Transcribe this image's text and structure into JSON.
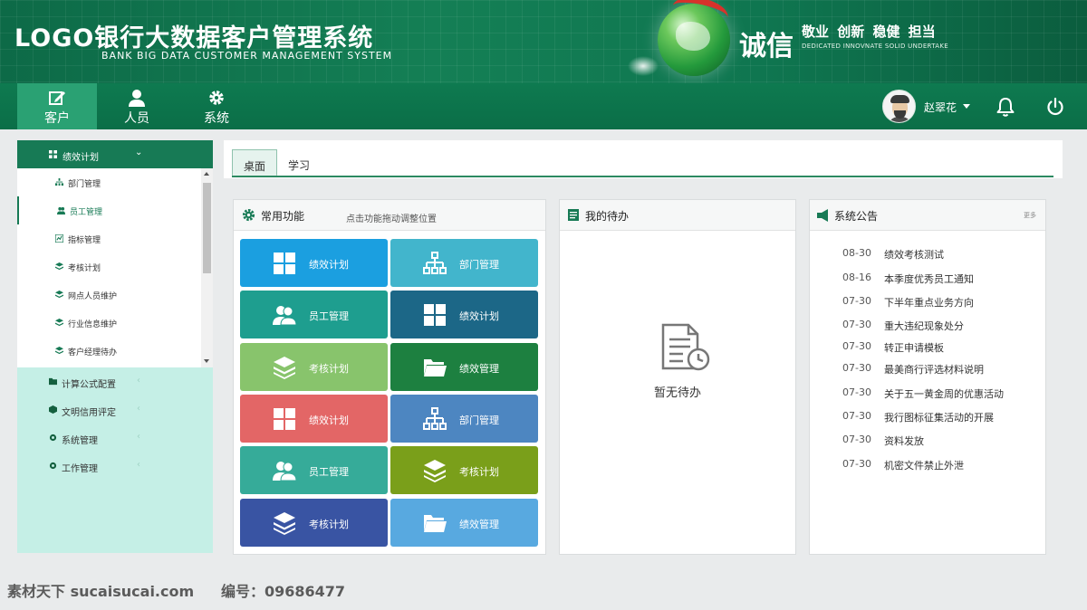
{
  "header": {
    "title": "LOGO银行大数据客户管理系统",
    "subtitle": "BANK BIG DATA CUSTOMER MANAGEMENT SYSTEM",
    "slogan": "诚信",
    "values": "敬业 创新 稳健 担当",
    "values_sub": "DEDICATED INNOVNATE SOLID UNDERTAKE"
  },
  "topnav": {
    "items": [
      {
        "label": "客户",
        "icon": "edit-icon",
        "active": true
      },
      {
        "label": "人员",
        "icon": "user-icon",
        "active": false
      },
      {
        "label": "系统",
        "icon": "gear-icon",
        "active": false
      }
    ],
    "user_name": "赵翠花"
  },
  "sidebar": {
    "head": "绩效计划",
    "subitems": [
      {
        "label": "部门管理",
        "icon": "org-icon"
      },
      {
        "label": "员工管理",
        "icon": "users-icon",
        "active": true
      },
      {
        "label": "指标管理",
        "icon": "chart-icon"
      },
      {
        "label": "考核计划",
        "icon": "layers-icon"
      },
      {
        "label": "网点人员维护",
        "icon": "layers-icon"
      },
      {
        "label": "行业信息维护",
        "icon": "layers-icon"
      },
      {
        "label": "客户经理待办",
        "icon": "layers-icon"
      }
    ],
    "groups": [
      {
        "label": "计算公式配置",
        "icon": "folder-icon"
      },
      {
        "label": "文明信用评定",
        "icon": "cube-icon"
      },
      {
        "label": "系统管理",
        "icon": "gear-icon"
      },
      {
        "label": "工作管理",
        "icon": "gear-icon"
      }
    ]
  },
  "tabs": [
    "桌面",
    "学习"
  ],
  "common": {
    "title": "常用功能",
    "hint": "点击功能拖动调整位置",
    "tiles": [
      {
        "label": "绩效计划",
        "icon": "grid-icon",
        "color": "#1b9fe0"
      },
      {
        "label": "部门管理",
        "icon": "org-icon",
        "color": "#42b5cc"
      },
      {
        "label": "员工管理",
        "icon": "users-icon",
        "color": "#1e9e8f"
      },
      {
        "label": "绩效计划",
        "icon": "grid-icon",
        "color": "#1c6787"
      },
      {
        "label": "考核计划",
        "icon": "layers-icon",
        "color": "#88c46c"
      },
      {
        "label": "绩效管理",
        "icon": "folder-icon",
        "color": "#1d8040"
      },
      {
        "label": "绩效计划",
        "icon": "grid-icon",
        "color": "#e36666"
      },
      {
        "label": "部门管理",
        "icon": "org-icon",
        "color": "#4d86c1"
      },
      {
        "label": "员工管理",
        "icon": "users-icon",
        "color": "#36ab99"
      },
      {
        "label": "考核计划",
        "icon": "layers-icon",
        "color": "#7a9f1a"
      },
      {
        "label": "考核计划",
        "icon": "layers-icon",
        "color": "#3954a3"
      },
      {
        "label": "绩效管理",
        "icon": "folder-icon",
        "color": "#58a9e0"
      }
    ]
  },
  "todo": {
    "title": "我的待办",
    "empty": "暂无待办"
  },
  "notice": {
    "title": "系统公告",
    "more": "更多",
    "items": [
      {
        "date": "08-30",
        "title": "绩效考核测试"
      },
      {
        "date": "08-16",
        "title": "本季度优秀员工通知"
      },
      {
        "date": "07-30",
        "title": "下半年重点业务方向"
      },
      {
        "date": "07-30",
        "title": "重大违纪现象处分"
      },
      {
        "date": "07-30",
        "title": "转正申请模板"
      },
      {
        "date": "07-30",
        "title": "最美商行评选材料说明"
      },
      {
        "date": "07-30",
        "title": "关于五一黄金周的优惠活动"
      },
      {
        "date": "07-30",
        "title": "我行图标征集活动的开展"
      },
      {
        "date": "07-30",
        "title": "资料发放"
      },
      {
        "date": "07-30",
        "title": "机密文件禁止外泄"
      }
    ]
  },
  "watermark": {
    "left": "素材天下 sucaisucai.com",
    "right": "编号：09686477"
  }
}
